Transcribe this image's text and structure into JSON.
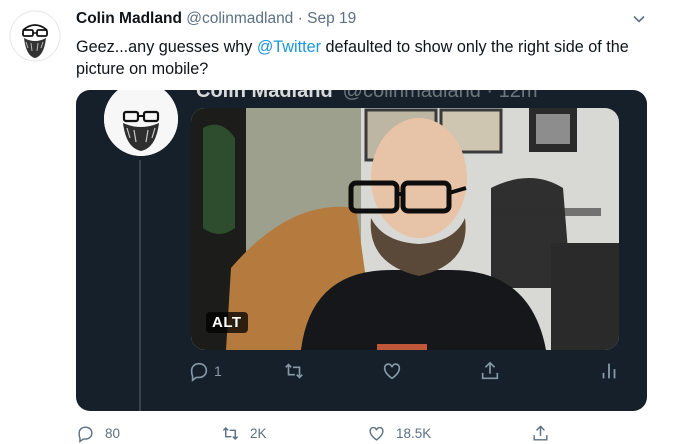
{
  "tweet": {
    "author_name": "Colin Madland",
    "handle": "@colinmadland",
    "separator": "·",
    "date": "Sep 19",
    "text_before": "Geez...any guesses why ",
    "mention": "@Twitter",
    "text_after": " defaulted to show only the right side of the picture on mobile?"
  },
  "embedded": {
    "header_name": "Colin Madland",
    "header_handle": "@colinmadland · 12m",
    "alt_label": "ALT",
    "reply_count": "1"
  },
  "actions": {
    "replies": "80",
    "retweets": "2K",
    "likes": "18.5K"
  },
  "icons": {
    "caret": "chevron-down-icon",
    "reply": "reply-icon",
    "retweet": "retweet-icon",
    "like": "heart-icon",
    "share": "share-icon",
    "analytics": "analytics-icon"
  },
  "colors": {
    "link": "#1b95e0",
    "card_bg": "#15202b",
    "muted": "#5b7083"
  }
}
